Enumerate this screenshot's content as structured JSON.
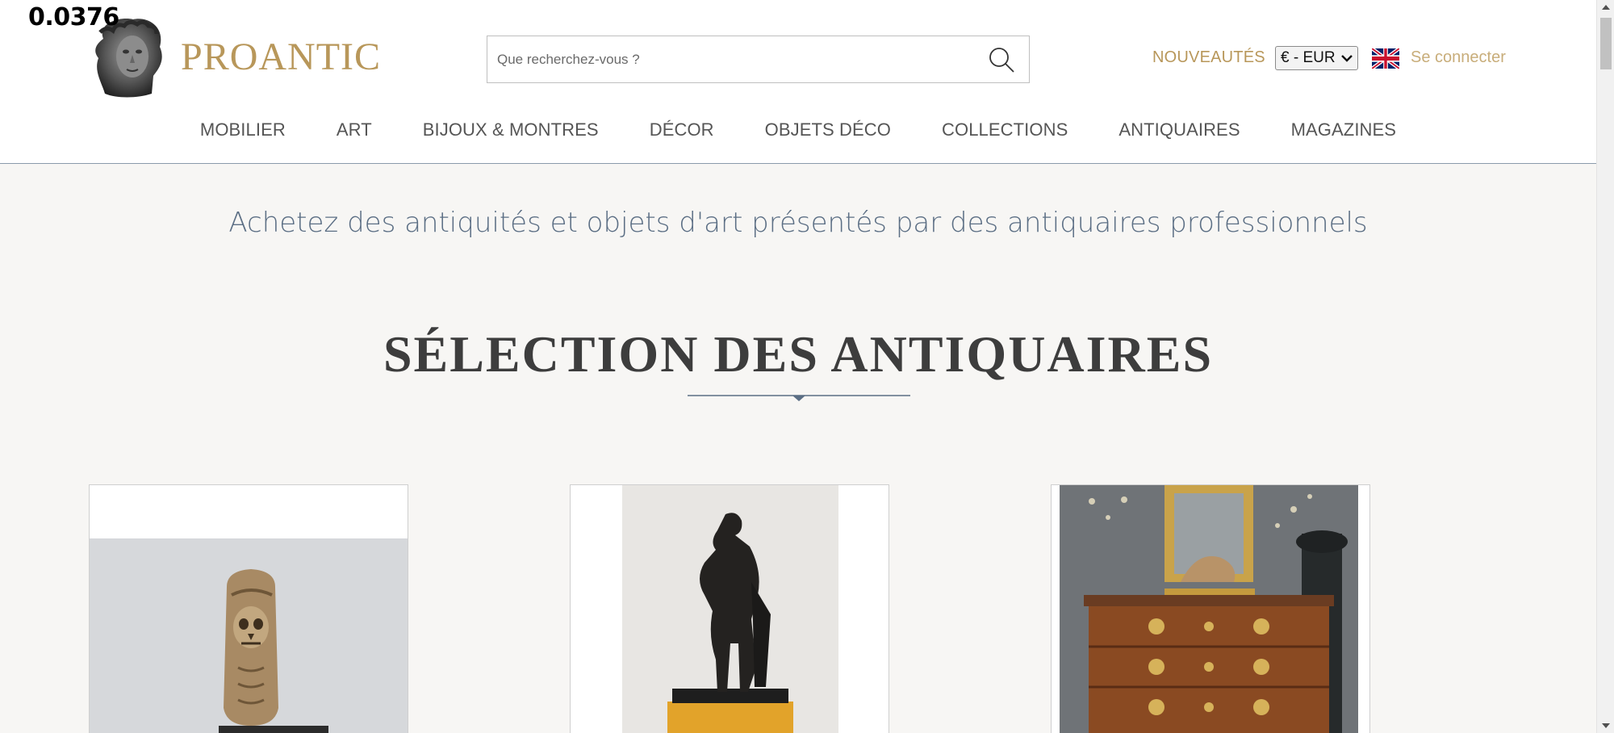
{
  "overlay": {
    "counter": "0.0376"
  },
  "header": {
    "brand": "PROANTIC",
    "search_placeholder": "Que recherchez-vous ?",
    "nouveautes": "NOUVEAUTÉS",
    "currency": "€ - EUR",
    "language_flag": "uk-flag-icon",
    "login": "Se connecter"
  },
  "nav": {
    "items": [
      {
        "label": "MOBILIER"
      },
      {
        "label": "ART"
      },
      {
        "label": "BIJOUX & MONTRES"
      },
      {
        "label": "DÉCOR"
      },
      {
        "label": "OBJETS DÉCO"
      },
      {
        "label": "COLLECTIONS"
      },
      {
        "label": "ANTIQUAIRES"
      },
      {
        "label": "MAGAZINES"
      }
    ]
  },
  "main": {
    "tagline": "Achetez des antiquités et objets d'art présentés par des antiquaires professionnels",
    "section_title": "SÉLECTION DES ANTIQUAIRES"
  },
  "colors": {
    "gold": "#b8975a",
    "login_gold": "#c8ad7a",
    "tagline_blue": "#5b6e84",
    "background": "#f7f6f4"
  }
}
